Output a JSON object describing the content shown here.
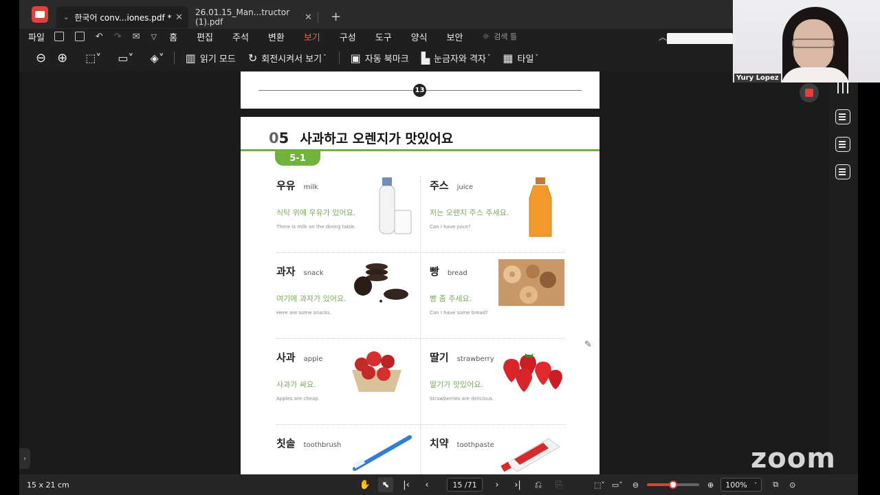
{
  "tabs": [
    {
      "label": "한국어 conv...iones.pdf *",
      "active": true
    },
    {
      "label": "26.01.15_Man...tructor (1).pdf",
      "active": false
    }
  ],
  "menu": [
    "파일",
    "홈",
    "편집",
    "주석",
    "변환",
    "보기",
    "구성",
    "도구",
    "양식",
    "보안"
  ],
  "menu_active": "보기",
  "search_label": "검색 틀",
  "toolbar": {
    "reading_mode": "읽기 모드",
    "rotate_view": "회전시켜서 보기",
    "auto_bookmark": "자동 북마크",
    "ruler_grid": "눈금자와 격자",
    "tile": "타일"
  },
  "document": {
    "prev_page_number": "13",
    "lesson_number_prefix": "0",
    "lesson_number": "5",
    "lesson_title": "사과하고 오렌지가 맛있어요",
    "section_tag": "5-1",
    "items": [
      {
        "ko": "우유",
        "en": "milk",
        "sentence": "식탁 위에 우유가 있어요.",
        "translation": "There is milk on the dining table."
      },
      {
        "ko": "주스",
        "en": "juice",
        "sentence": "저는 오렌지 주스 주세요.",
        "translation": "Can I have juice?"
      },
      {
        "ko": "과자",
        "en": "snack",
        "sentence": "여기에 과자가 있어요.",
        "translation": "Here are some snacks."
      },
      {
        "ko": "빵",
        "en": "bread",
        "sentence": "빵 좀 주세요.",
        "translation": "Can I have some bread?"
      },
      {
        "ko": "사과",
        "en": "apple",
        "sentence": "사과가 싸요.",
        "translation": "Apples are cheap."
      },
      {
        "ko": "딸기",
        "en": "strawberry",
        "sentence": "딸기가 맛있어요.",
        "translation": "Strawberries are delicious."
      },
      {
        "ko": "칫솔",
        "en": "toothbrush"
      },
      {
        "ko": "치약",
        "en": "toothpaste"
      }
    ]
  },
  "statusbar": {
    "page_size": "15 x 21 cm",
    "page_indicator": "15 /71",
    "zoom": "100%",
    "zoom_slider_fraction": 0.5
  },
  "video": {
    "participant_name": "Yury Lopez"
  },
  "watermark": "zoom"
}
